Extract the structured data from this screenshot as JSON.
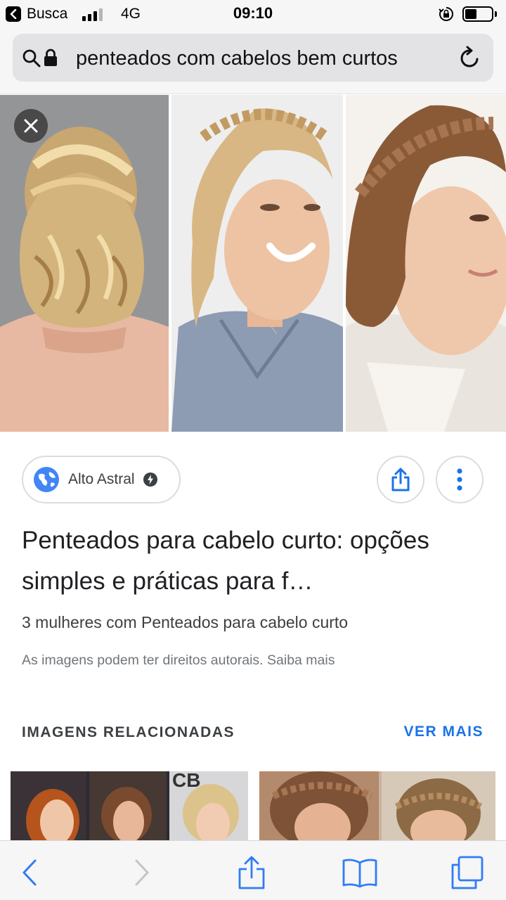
{
  "status_bar": {
    "back_app_label": "Busca",
    "network": "4G",
    "time": "09:10",
    "battery_level": 0.45
  },
  "url_bar": {
    "url_text": "penteados com cabelos bem curtos"
  },
  "source": {
    "name": "Alto Astral"
  },
  "result": {
    "title": "Penteados para cabelo curto: opções simples e práticas para f…",
    "subtitle": "3 mulheres com Penteados para cabelo curto",
    "rights_text": "As imagens podem ter direitos autorais.",
    "learn_more": "Saiba mais"
  },
  "related": {
    "heading": "IMAGENS RELACIONADAS",
    "see_more": "VER MAIS"
  },
  "colors": {
    "accent": "#1a73e8",
    "toolbar_icon": "#2f7cf6",
    "toolbar_disabled": "#c4c4c4"
  },
  "icons": [
    "back-arrow-icon",
    "search-icon",
    "lock-icon",
    "reload-icon",
    "close-icon",
    "globe-icon",
    "amp-bolt-icon",
    "share-icon",
    "more-vertical-icon",
    "back-icon",
    "forward-icon",
    "bookmarks-icon",
    "tabs-icon"
  ]
}
